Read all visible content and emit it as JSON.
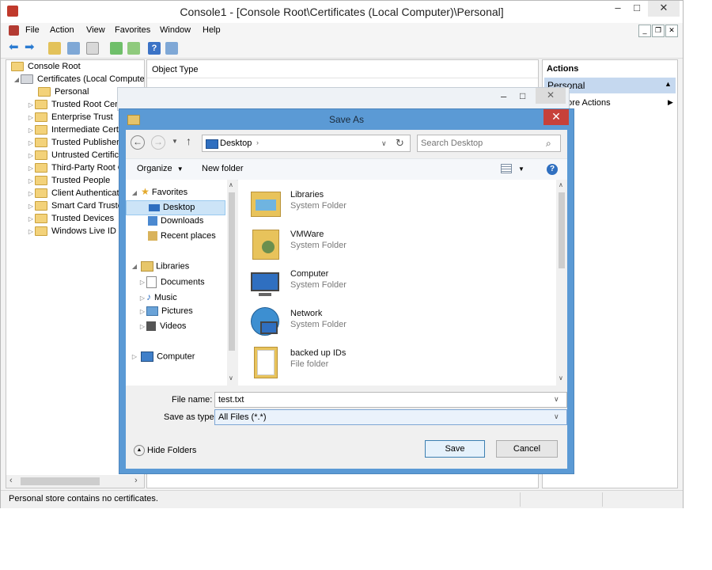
{
  "mmc": {
    "title": "Console1 - [Console Root\\Certificates (Local Computer)\\Personal]",
    "menu": [
      "File",
      "Action",
      "View",
      "Favorites",
      "Window",
      "Help"
    ],
    "caption": {
      "minimize": "–",
      "maximize": "□",
      "close": "✕"
    },
    "inner_caption": {
      "minimize": "_",
      "restore": "❐",
      "close": "✕"
    },
    "tree": {
      "root": "Console Root",
      "certificates": "Certificates (Local Computer)",
      "items": [
        "Personal",
        "Trusted Root Certification Authorities",
        "Enterprise Trust",
        "Intermediate Certification Authorities",
        "Trusted Publishers",
        "Untrusted Certificates",
        "Third-Party Root Certification Authorities",
        "Trusted People",
        "Client Authentication Issuers",
        "Smart Card Trusted Roots",
        "Trusted Devices",
        "Windows Live ID Token Issuer"
      ]
    },
    "center_header": "Object Type",
    "actions": {
      "header": "Actions",
      "group": "Personal",
      "more": "More Actions"
    },
    "status": "Personal store contains no certificates."
  },
  "dialog": {
    "title": "Save As",
    "close": "✕",
    "breadcrumb": "Desktop",
    "search_placeholder": "Search Desktop",
    "organize": "Organize",
    "new_folder": "New folder",
    "nav": {
      "favorites": "Favorites",
      "favorites_items": [
        "Desktop",
        "Downloads",
        "Recent places"
      ],
      "libraries": "Libraries",
      "libraries_items": [
        "Documents",
        "Music",
        "Pictures",
        "Videos"
      ],
      "computer": "Computer"
    },
    "files": [
      {
        "name": "Libraries",
        "type": "System Folder",
        "icon": "libraries-icon"
      },
      {
        "name": "VMWare",
        "type": "System Folder",
        "icon": "user-folder-icon"
      },
      {
        "name": "Computer",
        "type": "System Folder",
        "icon": "computer-icon"
      },
      {
        "name": "Network",
        "type": "System Folder",
        "icon": "network-icon"
      },
      {
        "name": "backed up IDs",
        "type": "File folder",
        "icon": "folder-icon"
      }
    ],
    "file_name_label": "File name:",
    "file_name_value": "test.txt",
    "save_type_label": "Save as type:",
    "save_type_value": "All Files (*.*)",
    "hide_folders": "Hide Folders",
    "save": "Save",
    "cancel": "Cancel"
  }
}
